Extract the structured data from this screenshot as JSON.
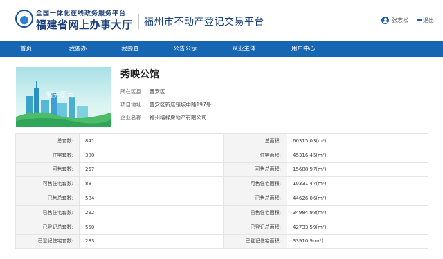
{
  "header": {
    "logo_line1": "全国一体化在线政务服务平台",
    "logo_line2": "福建省网上办事大厅",
    "platform_title": "福州市不动产登记交易平台",
    "user_name": "张志松",
    "logout_label": "退出"
  },
  "nav": {
    "items": [
      {
        "label": "首页"
      },
      {
        "label": "我要办"
      },
      {
        "label": "我要查"
      },
      {
        "label": "公告公示"
      },
      {
        "label": "从业主体"
      },
      {
        "label": "用户中心"
      }
    ]
  },
  "project": {
    "name": "秀映公馆",
    "image_caption": "暂无图片",
    "district_label": "所在区县",
    "district_value": "晋安区",
    "address_label": "项目地址",
    "address_value": "晋安区新店镇坂中路197号",
    "company_label": "企业名称",
    "company_value": "福州榕禄房地产有限公司"
  },
  "stats": {
    "rows": [
      {
        "left_label": "总套数:",
        "left_value": "841",
        "right_label": "总面积:",
        "right_value": "60315.03(m²)"
      },
      {
        "left_label": "住宅套数:",
        "left_value": "380",
        "right_label": "住宅面积:",
        "right_value": "45316.45(m²)"
      },
      {
        "left_label": "可售套数:",
        "left_value": "257",
        "right_label": "可售总面积:",
        "right_value": "15688.97(m²)"
      },
      {
        "left_label": "可售住宅套数:",
        "left_value": "88",
        "right_label": "可售住宅面积:",
        "right_value": "10331.47(m²)"
      },
      {
        "left_label": "已售总套数:",
        "left_value": "584",
        "right_label": "已售总面积:",
        "right_value": "44626.06(m²)"
      },
      {
        "left_label": "已售住宅套数:",
        "left_value": "292",
        "right_label": "已售住宅面积:",
        "right_value": "34984.98(m²)"
      },
      {
        "left_label": "已登记总套数:",
        "left_value": "550",
        "right_label": "已登记总面积:",
        "right_value": "42733.59(m²)"
      },
      {
        "left_label": "已登记住宅套数:",
        "left_value": "283",
        "right_label": "已登记住宅面积:",
        "right_value": "33910.9(m²)"
      }
    ]
  },
  "colors": {
    "nav_bg": "#1766b3",
    "brand_dark": "#1a3f7a",
    "icon_blue": "#1f5fae"
  }
}
